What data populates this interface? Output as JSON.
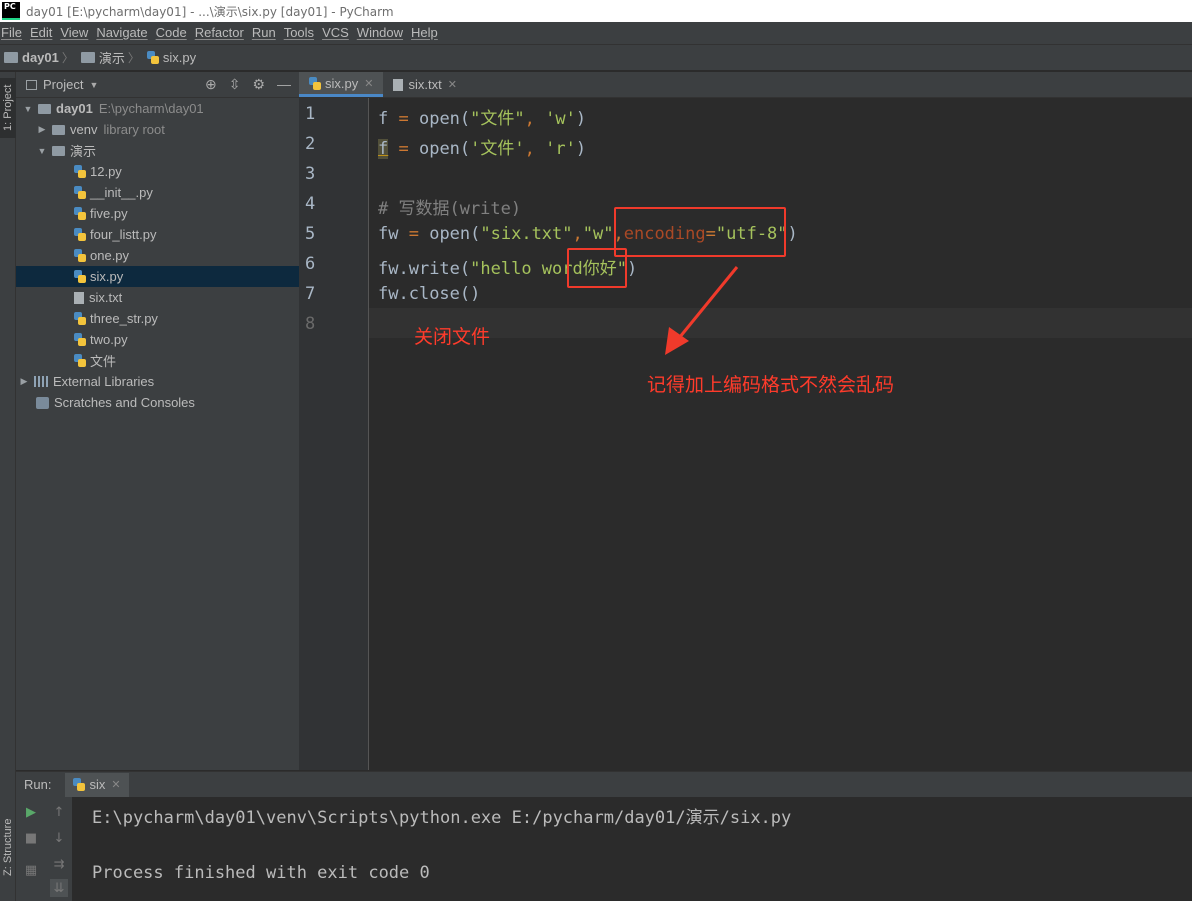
{
  "window": {
    "title": "day01 [E:\\pycharm\\day01] - ...\\演示\\six.py [day01] - PyCharm",
    "logo_text": "PC"
  },
  "menu": [
    "File",
    "Edit",
    "View",
    "Navigate",
    "Code",
    "Refactor",
    "Run",
    "Tools",
    "VCS",
    "Window",
    "Help"
  ],
  "breadcrumb": [
    "day01",
    "演示",
    "six.py"
  ],
  "side_tabs": {
    "project": "1: Project",
    "structure": "Z: Structure"
  },
  "project_panel": {
    "title": "Project",
    "root": {
      "name": "day01",
      "path": "E:\\pycharm\\day01"
    },
    "venv": {
      "name": "venv",
      "note": "library root"
    },
    "folder": "演示",
    "files": [
      "12.py",
      "__init__.py",
      "five.py",
      "four_listt.py",
      "one.py",
      "six.py",
      "six.txt",
      "three_str.py",
      "two.py",
      "文件"
    ],
    "selected": "six.py",
    "external": "External Libraries",
    "scratches": "Scratches and Consoles"
  },
  "editor": {
    "tabs": [
      {
        "label": "six.py",
        "active": true
      },
      {
        "label": "six.txt",
        "active": false
      }
    ],
    "line_numbers": [
      "1",
      "2",
      "3",
      "4",
      "5",
      "6",
      "7",
      "8"
    ],
    "lines": {
      "l1": {
        "var": "f",
        "eq": " = ",
        "fn": "open(",
        "s1": "\"文件\"",
        "c": ", ",
        "s2": "'w'",
        "end": ")"
      },
      "l2": {
        "var": "f",
        "eq": " = ",
        "fn": "open(",
        "s1": "'文件'",
        "c": ", ",
        "s2": "'r'",
        "end": ")"
      },
      "l4": {
        "comment": "# 写数据(write)"
      },
      "l5": {
        "a": "fw",
        "eq": " = ",
        "fn": "open(",
        "s1": "\"six.txt\"",
        "c1": ",",
        "s2": "\"w\"",
        "c2": ",",
        "param": "encoding",
        "eq2": "=",
        "s3": "\"utf-8\"",
        "end": ")"
      },
      "l6": {
        "a": "fw.",
        "fn": "write(",
        "s1": "\"hello word你好\"",
        "end": ")"
      },
      "l7": {
        "a": "fw.",
        "fn": "close()"
      }
    }
  },
  "annotations": {
    "close_file": "关闭文件",
    "reminder": "记得加上编码格式不然会乱码"
  },
  "run_panel": {
    "label": "Run:",
    "tab": "six",
    "output": [
      "E:\\pycharm\\day01\\venv\\Scripts\\python.exe E:/pycharm/day01/演示/six.py",
      "",
      "Process finished with exit code 0"
    ]
  },
  "colors": {
    "annotation": "#f03a2b",
    "selection": "#0d293e",
    "string": "#a5c25c",
    "keyword": "#cc7832"
  }
}
